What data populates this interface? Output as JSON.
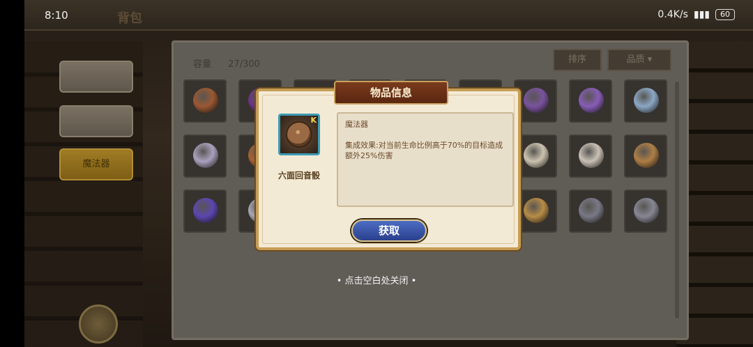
{
  "status_bar": {
    "time": "8:10",
    "network_speed": "0.4K/s",
    "battery": "60"
  },
  "page": {
    "title": "背包"
  },
  "categories": [
    {
      "label": "",
      "active": false
    },
    {
      "label": "",
      "active": false
    },
    {
      "label": "魔法器",
      "active": true
    }
  ],
  "inventory": {
    "capacity_label": "容量",
    "capacity_value": "27/300",
    "sort_label": "排序",
    "quality_label": "品质",
    "item_colors": [
      "#b0643a",
      "#7a3d9a",
      "#5a4a40",
      "#4a4a58",
      "#6a5a4a",
      "#4a6a3a",
      "#8a5fb4",
      "#9a6ad0",
      "#9fbfe0",
      "#c0b8d8",
      "#c0703a",
      "#5a4a40",
      "#6a5a4a",
      "#5a5a5a",
      "#4a4a4a",
      "#e8dec8",
      "#e6dccf",
      "#c69050",
      "#6a50c8",
      "#c0c0d0",
      "#5a4a40",
      "#4a4a58",
      "#6a5a4a",
      "#5a5a5a",
      "#d0a050",
      "#8a8a98",
      "#9a9aa8"
    ]
  },
  "modal": {
    "title": "物品信息",
    "item_name": "六面回音骰",
    "rarity_mark": "K",
    "type": "魔法器",
    "effect": "集成效果:对当前生命比例高于70%的目标造成额外25%伤害",
    "get_button": "获取"
  },
  "close_hint": "• 点击空白处关闭 •"
}
